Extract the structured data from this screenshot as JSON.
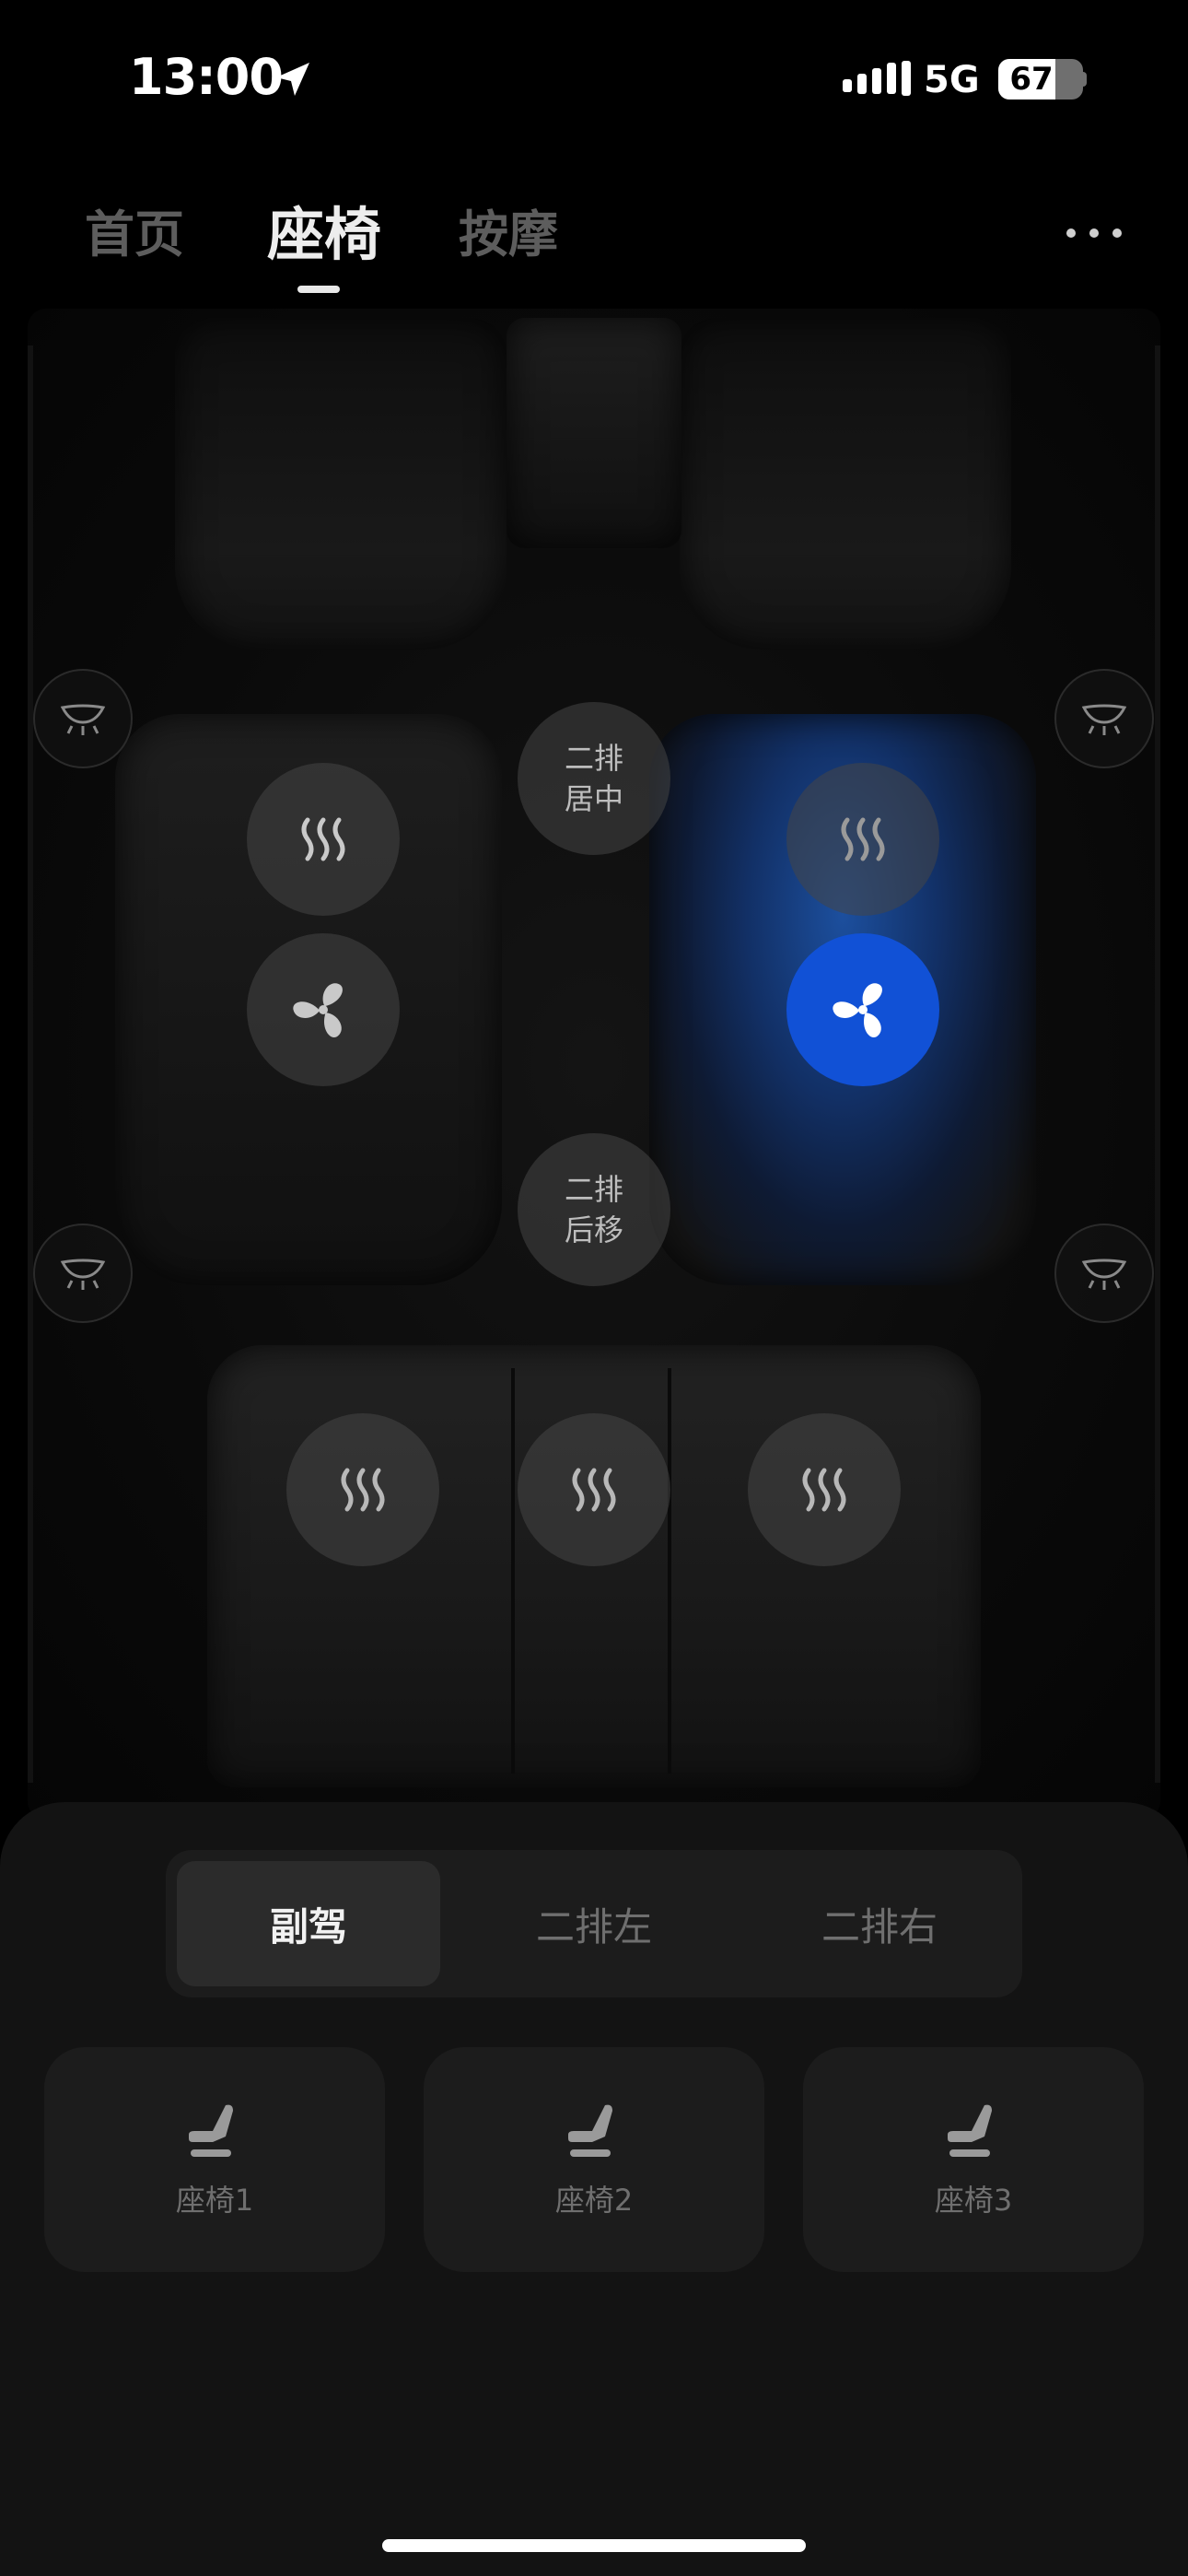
{
  "status": {
    "time": "13:00",
    "network": "5G",
    "battery": "67",
    "battery_level": 0.67
  },
  "tabs": [
    {
      "label": "首页",
      "active": false
    },
    {
      "label": "座椅",
      "active": true
    },
    {
      "label": "按摩",
      "active": false
    }
  ],
  "car": {
    "center_buttons": [
      {
        "line1": "二排",
        "line2": "居中"
      },
      {
        "line1": "二排",
        "line2": "后移"
      }
    ],
    "active_seat": "second-row-right",
    "active_function": "ventilation",
    "accent_color": "#1151d6"
  },
  "segment": {
    "items": [
      "副驾",
      "二排左",
      "二排右"
    ],
    "selected": "副驾"
  },
  "cards": [
    {
      "label": "座椅1",
      "icon": "seat-icon"
    },
    {
      "label": "座椅2",
      "icon": "seat-icon"
    },
    {
      "label": "座椅3",
      "icon": "seat-icon"
    }
  ]
}
